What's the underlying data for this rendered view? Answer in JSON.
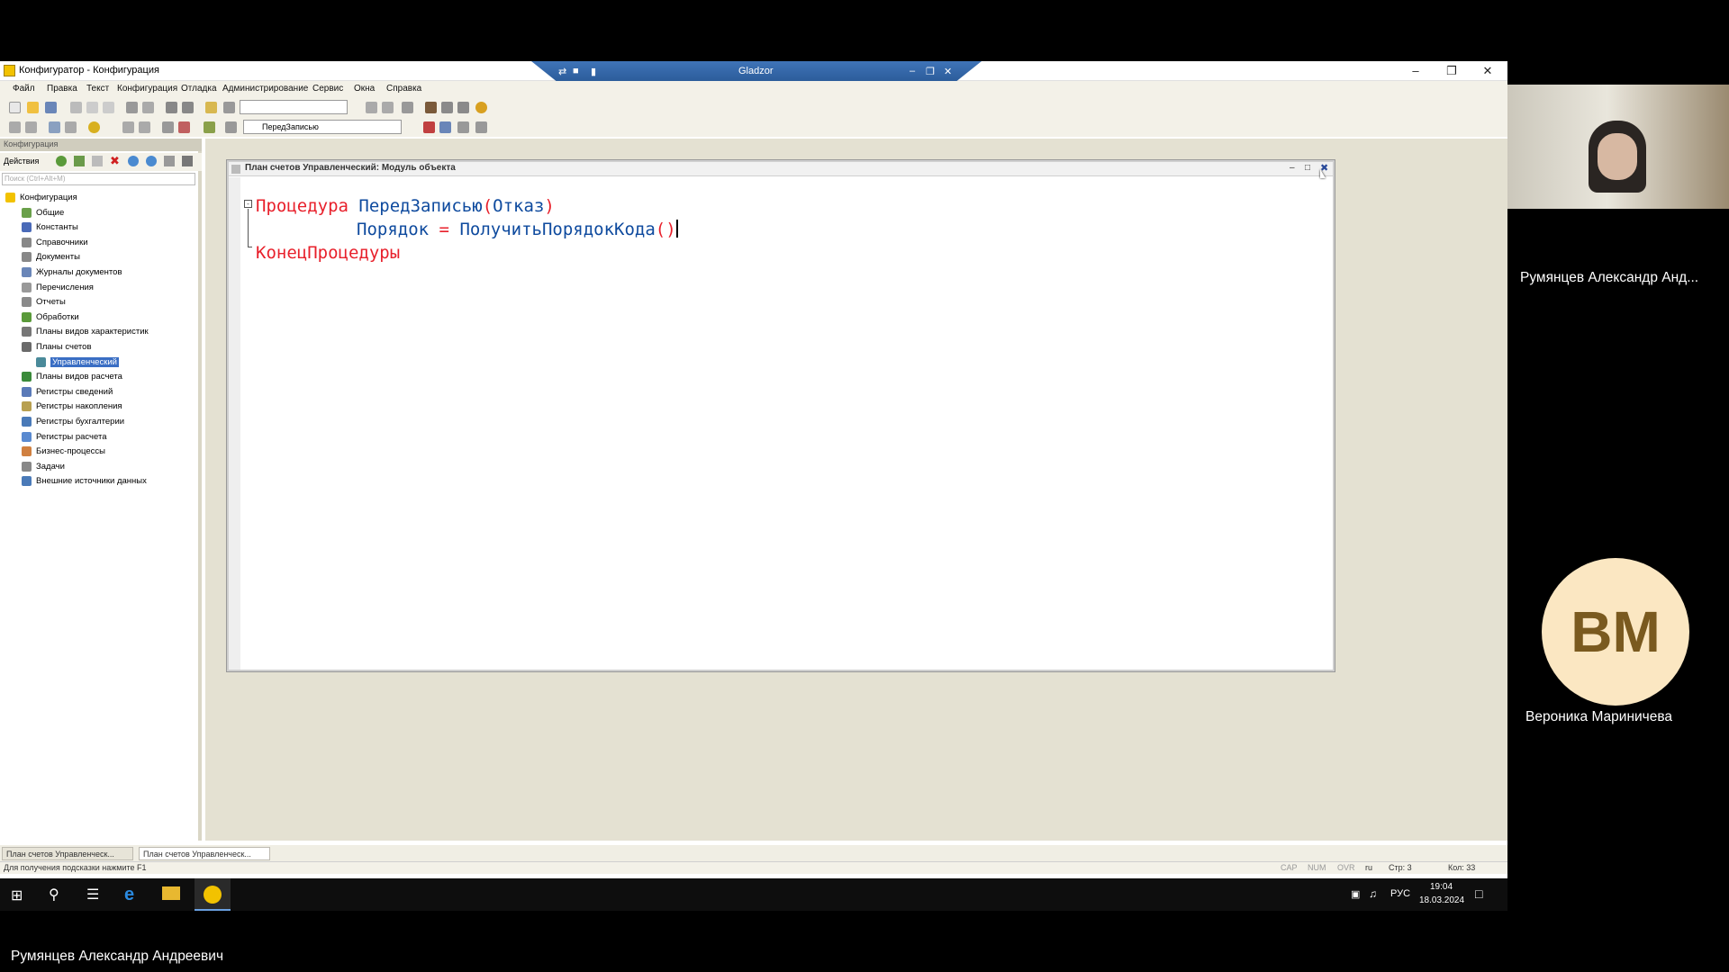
{
  "app": {
    "title": "Конфигуратор - Конфигурация",
    "remote_session": "Gladzor"
  },
  "menu": [
    "Файл",
    "Правка",
    "Текст",
    "Конфигурация",
    "Отладка",
    "Администрирование",
    "Сервис",
    "Окна",
    "Справка"
  ],
  "toolbar": {
    "procedure_combo": "ПередЗаписью"
  },
  "left_panel": {
    "header": "Конфигурация",
    "actions_label": "Действия",
    "search_placeholder": "Поиск (Ctrl+Alt+M)",
    "tree": [
      {
        "label": "Конфигурация",
        "icon": "config-icon"
      },
      {
        "label": "Общие",
        "icon": "common-icon"
      },
      {
        "label": "Константы",
        "icon": "constants-icon"
      },
      {
        "label": "Справочники",
        "icon": "catalogs-icon"
      },
      {
        "label": "Документы",
        "icon": "documents-icon"
      },
      {
        "label": "Журналы документов",
        "icon": "journals-icon"
      },
      {
        "label": "Перечисления",
        "icon": "enums-icon"
      },
      {
        "label": "Отчеты",
        "icon": "reports-icon"
      },
      {
        "label": "Обработки",
        "icon": "processing-icon"
      },
      {
        "label": "Планы видов характеристик",
        "icon": "chart-characteristics-icon"
      },
      {
        "label": "Планы счетов",
        "icon": "chart-accounts-icon"
      },
      {
        "label": "Управленческий",
        "icon": "chart-accounts-item-icon"
      },
      {
        "label": "Планы видов расчета",
        "icon": "calc-types-icon"
      },
      {
        "label": "Регистры сведений",
        "icon": "info-registers-icon"
      },
      {
        "label": "Регистры накопления",
        "icon": "accum-registers-icon"
      },
      {
        "label": "Регистры бухгалтерии",
        "icon": "accounting-registers-icon"
      },
      {
        "label": "Регистры расчета",
        "icon": "calc-registers-icon"
      },
      {
        "label": "Бизнес-процессы",
        "icon": "business-process-icon"
      },
      {
        "label": "Задачи",
        "icon": "tasks-icon"
      },
      {
        "label": "Внешние источники данных",
        "icon": "external-data-icon"
      }
    ]
  },
  "editor": {
    "title": "План счетов Управленческий: Модуль объекта",
    "line1_kw": "Процедура",
    "line1_name": "ПередЗаписью",
    "line1_open": "(",
    "line1_param": "Отказ",
    "line1_close": ")",
    "line2_var": "Порядок",
    "line2_eq": "=",
    "line2_func": "ПолучитьПорядокКода",
    "line2_parens": "()",
    "line3_kw": "КонецПроцедуры"
  },
  "doc_tabs": [
    "План счетов Управленческ...",
    "План счетов Управленческ..."
  ],
  "status": {
    "hint": "Для получения подсказки нажмите F1",
    "cap": "CAP",
    "num": "NUM",
    "ovr": "OVR",
    "lang": "ru",
    "line": "Стр: 3",
    "col": "Кол: 33"
  },
  "win_taskbar": {
    "lang": "РУС",
    "time": "19:04",
    "date": "18.03.2024"
  },
  "participants": {
    "cam_name": "Румянцев Александр Анд...",
    "avatar_initials": "ВМ",
    "avatar_name": "Вероника Мариничева",
    "presenter_name": "Румянцев Александр Андреевич"
  }
}
